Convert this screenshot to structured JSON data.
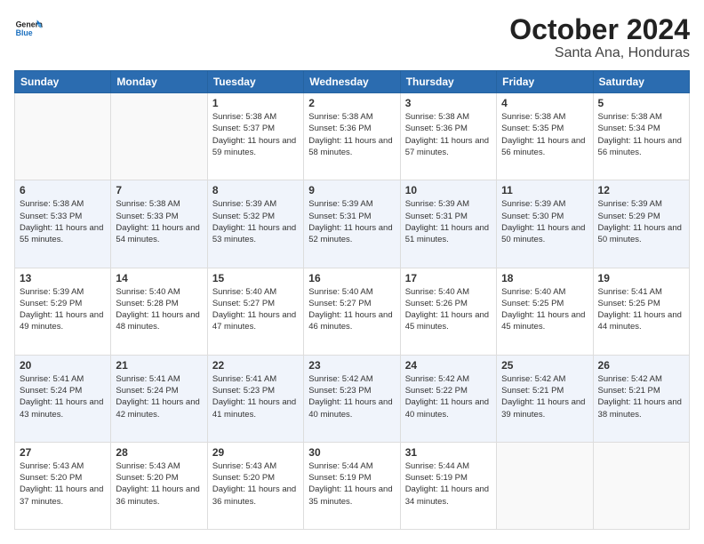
{
  "logo": {
    "line1": "General",
    "line2": "Blue"
  },
  "title": "October 2024",
  "subtitle": "Santa Ana, Honduras",
  "days_of_week": [
    "Sunday",
    "Monday",
    "Tuesday",
    "Wednesday",
    "Thursday",
    "Friday",
    "Saturday"
  ],
  "weeks": [
    [
      {
        "day": "",
        "info": ""
      },
      {
        "day": "",
        "info": ""
      },
      {
        "day": "1",
        "info": "Sunrise: 5:38 AM\nSunset: 5:37 PM\nDaylight: 11 hours and 59 minutes."
      },
      {
        "day": "2",
        "info": "Sunrise: 5:38 AM\nSunset: 5:36 PM\nDaylight: 11 hours and 58 minutes."
      },
      {
        "day": "3",
        "info": "Sunrise: 5:38 AM\nSunset: 5:36 PM\nDaylight: 11 hours and 57 minutes."
      },
      {
        "day": "4",
        "info": "Sunrise: 5:38 AM\nSunset: 5:35 PM\nDaylight: 11 hours and 56 minutes."
      },
      {
        "day": "5",
        "info": "Sunrise: 5:38 AM\nSunset: 5:34 PM\nDaylight: 11 hours and 56 minutes."
      }
    ],
    [
      {
        "day": "6",
        "info": "Sunrise: 5:38 AM\nSunset: 5:33 PM\nDaylight: 11 hours and 55 minutes."
      },
      {
        "day": "7",
        "info": "Sunrise: 5:38 AM\nSunset: 5:33 PM\nDaylight: 11 hours and 54 minutes."
      },
      {
        "day": "8",
        "info": "Sunrise: 5:39 AM\nSunset: 5:32 PM\nDaylight: 11 hours and 53 minutes."
      },
      {
        "day": "9",
        "info": "Sunrise: 5:39 AM\nSunset: 5:31 PM\nDaylight: 11 hours and 52 minutes."
      },
      {
        "day": "10",
        "info": "Sunrise: 5:39 AM\nSunset: 5:31 PM\nDaylight: 11 hours and 51 minutes."
      },
      {
        "day": "11",
        "info": "Sunrise: 5:39 AM\nSunset: 5:30 PM\nDaylight: 11 hours and 50 minutes."
      },
      {
        "day": "12",
        "info": "Sunrise: 5:39 AM\nSunset: 5:29 PM\nDaylight: 11 hours and 50 minutes."
      }
    ],
    [
      {
        "day": "13",
        "info": "Sunrise: 5:39 AM\nSunset: 5:29 PM\nDaylight: 11 hours and 49 minutes."
      },
      {
        "day": "14",
        "info": "Sunrise: 5:40 AM\nSunset: 5:28 PM\nDaylight: 11 hours and 48 minutes."
      },
      {
        "day": "15",
        "info": "Sunrise: 5:40 AM\nSunset: 5:27 PM\nDaylight: 11 hours and 47 minutes."
      },
      {
        "day": "16",
        "info": "Sunrise: 5:40 AM\nSunset: 5:27 PM\nDaylight: 11 hours and 46 minutes."
      },
      {
        "day": "17",
        "info": "Sunrise: 5:40 AM\nSunset: 5:26 PM\nDaylight: 11 hours and 45 minutes."
      },
      {
        "day": "18",
        "info": "Sunrise: 5:40 AM\nSunset: 5:25 PM\nDaylight: 11 hours and 45 minutes."
      },
      {
        "day": "19",
        "info": "Sunrise: 5:41 AM\nSunset: 5:25 PM\nDaylight: 11 hours and 44 minutes."
      }
    ],
    [
      {
        "day": "20",
        "info": "Sunrise: 5:41 AM\nSunset: 5:24 PM\nDaylight: 11 hours and 43 minutes."
      },
      {
        "day": "21",
        "info": "Sunrise: 5:41 AM\nSunset: 5:24 PM\nDaylight: 11 hours and 42 minutes."
      },
      {
        "day": "22",
        "info": "Sunrise: 5:41 AM\nSunset: 5:23 PM\nDaylight: 11 hours and 41 minutes."
      },
      {
        "day": "23",
        "info": "Sunrise: 5:42 AM\nSunset: 5:23 PM\nDaylight: 11 hours and 40 minutes."
      },
      {
        "day": "24",
        "info": "Sunrise: 5:42 AM\nSunset: 5:22 PM\nDaylight: 11 hours and 40 minutes."
      },
      {
        "day": "25",
        "info": "Sunrise: 5:42 AM\nSunset: 5:21 PM\nDaylight: 11 hours and 39 minutes."
      },
      {
        "day": "26",
        "info": "Sunrise: 5:42 AM\nSunset: 5:21 PM\nDaylight: 11 hours and 38 minutes."
      }
    ],
    [
      {
        "day": "27",
        "info": "Sunrise: 5:43 AM\nSunset: 5:20 PM\nDaylight: 11 hours and 37 minutes."
      },
      {
        "day": "28",
        "info": "Sunrise: 5:43 AM\nSunset: 5:20 PM\nDaylight: 11 hours and 36 minutes."
      },
      {
        "day": "29",
        "info": "Sunrise: 5:43 AM\nSunset: 5:20 PM\nDaylight: 11 hours and 36 minutes."
      },
      {
        "day": "30",
        "info": "Sunrise: 5:44 AM\nSunset: 5:19 PM\nDaylight: 11 hours and 35 minutes."
      },
      {
        "day": "31",
        "info": "Sunrise: 5:44 AM\nSunset: 5:19 PM\nDaylight: 11 hours and 34 minutes."
      },
      {
        "day": "",
        "info": ""
      },
      {
        "day": "",
        "info": ""
      }
    ]
  ]
}
